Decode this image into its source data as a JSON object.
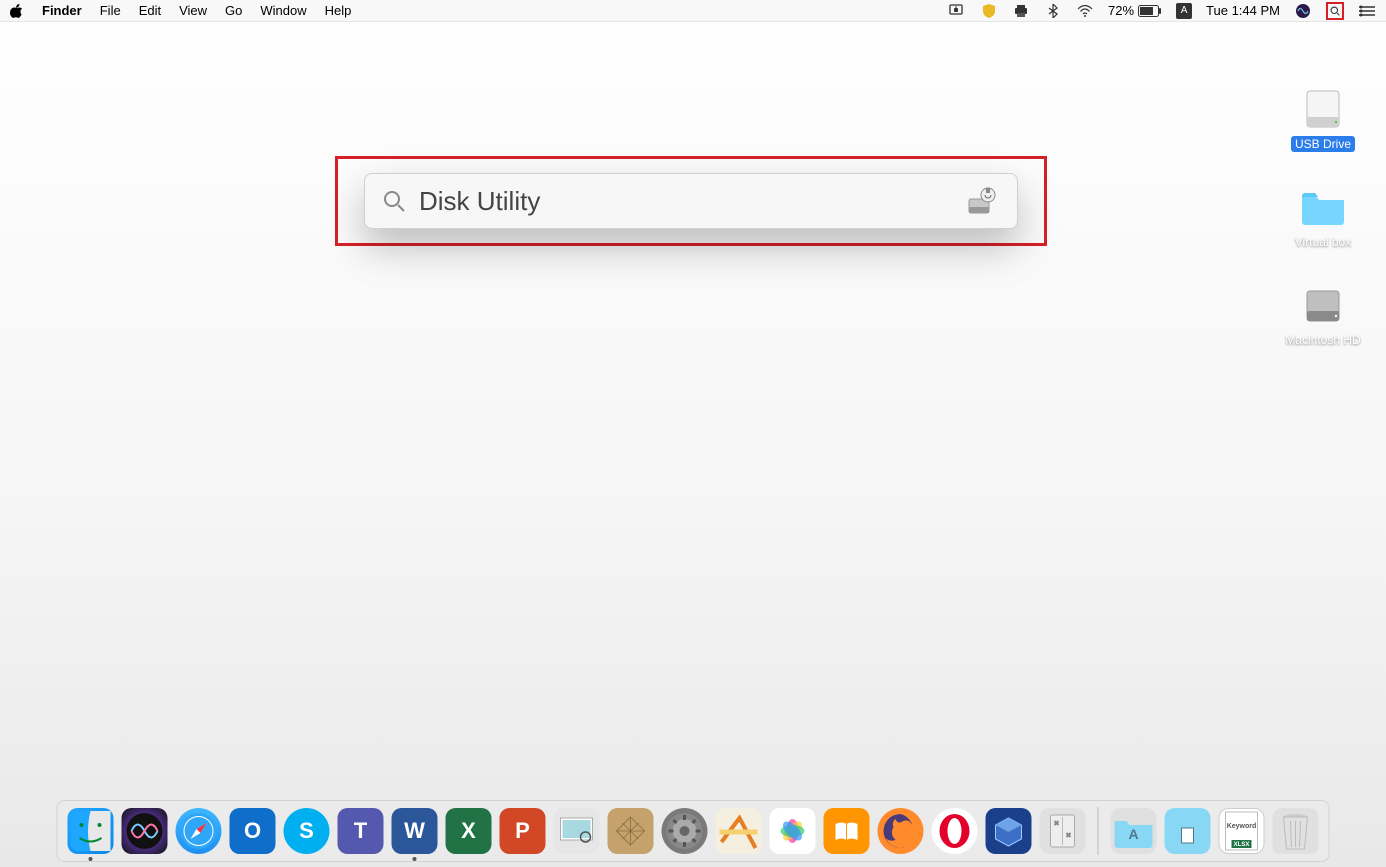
{
  "menubar": {
    "app": "Finder",
    "items": [
      "File",
      "Edit",
      "View",
      "Go",
      "Window",
      "Help"
    ],
    "battery_pct": "72%",
    "clock": "Tue 1:44 PM",
    "keyboard_badge": "A"
  },
  "desktop": {
    "items": [
      {
        "name": "USB Drive",
        "type": "external-disk",
        "selected": true
      },
      {
        "name": "Virtual box",
        "type": "folder",
        "selected": false
      },
      {
        "name": "Macintosh HD",
        "type": "internal-disk",
        "selected": false
      }
    ]
  },
  "spotlight": {
    "query": "Disk Utility",
    "top_hit": "Disk Utility"
  },
  "dock": {
    "apps": [
      {
        "id": "finder",
        "name": "Finder",
        "running": true,
        "letter": ""
      },
      {
        "id": "siri",
        "name": "Siri",
        "running": false,
        "letter": ""
      },
      {
        "id": "safari",
        "name": "Safari",
        "running": false,
        "letter": ""
      },
      {
        "id": "outlook",
        "name": "Microsoft Outlook",
        "running": false,
        "letter": "O"
      },
      {
        "id": "skype",
        "name": "Skype",
        "running": false,
        "letter": "S"
      },
      {
        "id": "teams",
        "name": "Microsoft Teams",
        "running": false,
        "letter": "T"
      },
      {
        "id": "word",
        "name": "Microsoft Word",
        "running": true,
        "letter": "W"
      },
      {
        "id": "excel",
        "name": "Microsoft Excel",
        "running": false,
        "letter": "X"
      },
      {
        "id": "ppt",
        "name": "Microsoft PowerPoint",
        "running": false,
        "letter": "P"
      },
      {
        "id": "preview",
        "name": "Preview",
        "running": false,
        "letter": ""
      },
      {
        "id": "sketch",
        "name": "Sketch",
        "running": false,
        "letter": ""
      },
      {
        "id": "settings",
        "name": "System Preferences",
        "running": false,
        "letter": ""
      },
      {
        "id": "maps",
        "name": "Maps",
        "running": false,
        "letter": ""
      },
      {
        "id": "photos",
        "name": "Photos",
        "running": false,
        "letter": ""
      },
      {
        "id": "books",
        "name": "Books",
        "running": false,
        "letter": ""
      },
      {
        "id": "firefox",
        "name": "Firefox",
        "running": false,
        "letter": ""
      },
      {
        "id": "opera",
        "name": "Opera",
        "running": false,
        "letter": "O"
      },
      {
        "id": "virtualbox",
        "name": "VirtualBox",
        "running": false,
        "letter": ""
      },
      {
        "id": "utility",
        "name": "Utilities",
        "running": false,
        "letter": ""
      }
    ],
    "right": [
      {
        "id": "launchpad",
        "name": "Applications",
        "letter": "A"
      },
      {
        "id": "docs",
        "name": "Documents",
        "letter": ""
      },
      {
        "id": "keyword",
        "name": "Keyword XLSX",
        "letter": "XLSX"
      },
      {
        "id": "trash",
        "name": "Trash",
        "letter": ""
      }
    ]
  }
}
